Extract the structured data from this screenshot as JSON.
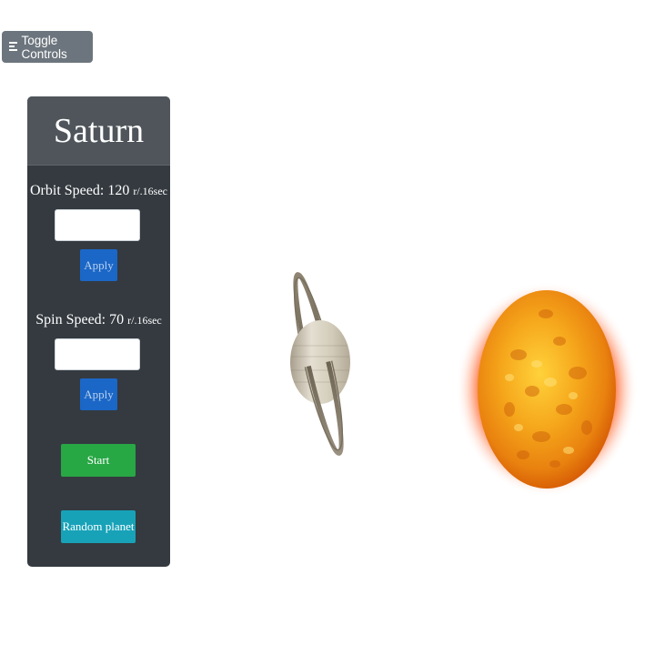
{
  "toggle": {
    "label": "Toggle Controls",
    "icon": "menu-lines-icon"
  },
  "panel": {
    "planet_name": "Saturn",
    "orbit_speed": {
      "label": "Orbit Speed: 120",
      "unit": "r/.16sec",
      "value": "",
      "apply_label": "Apply"
    },
    "spin_speed": {
      "label": "Spin Speed: 70",
      "unit": "r/.16sec",
      "value": "",
      "apply_label": "Apply"
    },
    "start_label": "Start",
    "random_label": "Random planet"
  },
  "scene": {
    "planet": "saturn",
    "star": "sun"
  },
  "colors": {
    "panel_bg": "#343a40",
    "header_bg": "#4f555b",
    "toggle_bg": "#6c757d",
    "apply_bg": "#1b67c7",
    "start_bg": "#28a745",
    "random_bg": "#17a2b8"
  }
}
